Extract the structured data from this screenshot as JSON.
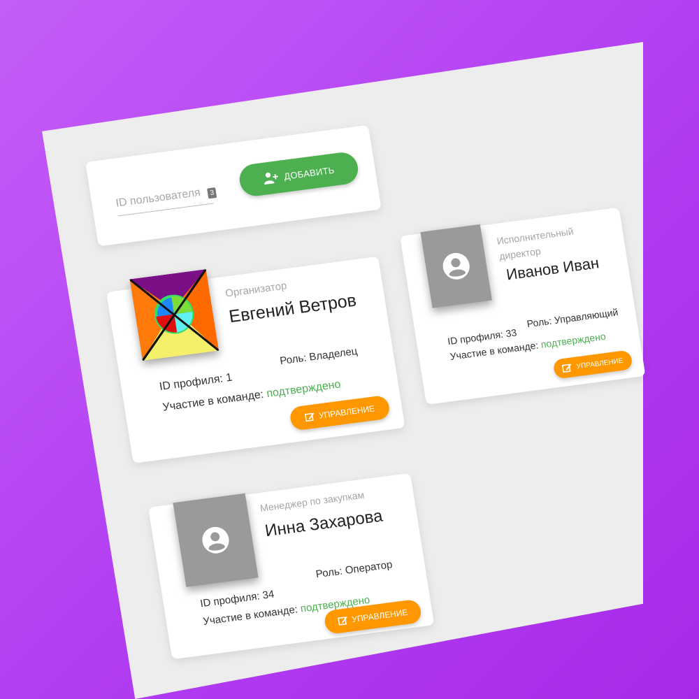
{
  "search": {
    "placeholder": "ID пользователя",
    "badge": "3",
    "add_label": "ДОБАВИТЬ"
  },
  "members": [
    {
      "role_title": "Организатор",
      "name": "Евгений Ветров",
      "profile_id": "ID профиля: 1",
      "role": "Роль: Владелец",
      "participation_label": "Участие в команде: ",
      "participation_status": "подтверждено",
      "manage_label": "УПРАВЛЕНИЕ",
      "avatar": "custom-geometric-avatar"
    },
    {
      "role_title": "Исполнительный директор",
      "name": "Иванов Иван",
      "profile_id": "ID профиля: 33",
      "role": "Роль: Управляющий",
      "participation_label": "Участие в команде: ",
      "participation_status": "подтверждено",
      "manage_label": "УПРАВЛЕНИЕ",
      "avatar": "default-user-avatar"
    },
    {
      "role_title": "Менеджер по закупкам",
      "name": "Инна Захарова",
      "profile_id": "ID профиля: 34",
      "role": "Роль: Оператор",
      "participation_label": "Участие в команде: ",
      "participation_status": "подтверждено",
      "manage_label": "УПРАВЛЕНИЕ",
      "avatar": "default-user-avatar"
    }
  ],
  "colors": {
    "background": "#b13df2",
    "panel": "#ededed",
    "add_button": "#4caf50",
    "manage_button": "#ff9800",
    "status_confirmed": "#4caf50"
  }
}
